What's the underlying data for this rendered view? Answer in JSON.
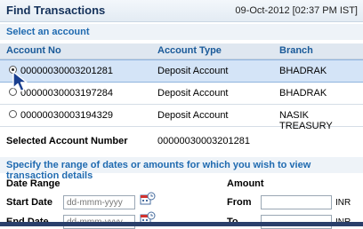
{
  "header": {
    "title": "Find Transactions",
    "timestamp": "09-Oct-2012 [02:37 PM IST]"
  },
  "select_section": {
    "title": "Select an account"
  },
  "columns": {
    "account_no": "Account No",
    "account_type": "Account Type",
    "branch": "Branch"
  },
  "accounts": [
    {
      "account_no": "00000030003201281",
      "account_type": "Deposit Account",
      "branch": "BHADRAK",
      "selected": true
    },
    {
      "account_no": "00000030003197284",
      "account_type": "Deposit Account",
      "branch": "BHADRAK",
      "selected": false
    },
    {
      "account_no": "00000030003194329",
      "account_type": "Deposit Account",
      "branch": "NASIK TREASURY",
      "selected": false
    }
  ],
  "selected_account": {
    "label": "Selected Account Number",
    "value": "00000030003201281"
  },
  "range_section": {
    "title": "Specify the range of dates or amounts for which you wish to view transaction details"
  },
  "date_range": {
    "label": "Date Range",
    "start_label": "Start Date",
    "start_placeholder": "dd-mmm-yyyy",
    "end_label": "End Date",
    "end_placeholder": "dd-mmm-yyyy"
  },
  "amount": {
    "label": "Amount",
    "from_label": "From",
    "to_label": "To",
    "currency": "INR"
  },
  "colors": {
    "selected_row": "#d4e4f7",
    "header_text": "#1a5a99",
    "section_text": "#1f6ab0"
  }
}
